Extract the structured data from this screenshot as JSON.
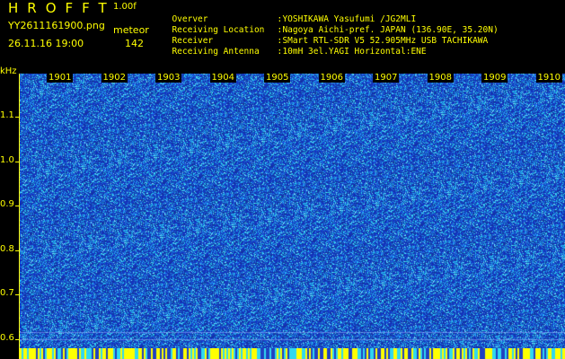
{
  "header": {
    "title": "HROFFT",
    "version": "1.00f",
    "filename": "YY2611161900.png",
    "datetime": "26.11.16 19:00",
    "meteor_label": "meteor",
    "meteor_count": "142"
  },
  "info": [
    {
      "label": "Overver",
      "value": "YOSHIKAWA Yasufumi /JG2MLI"
    },
    {
      "label": "Receiving Location",
      "value": "Nagoya Aichi-pref. JAPAN (136.90E, 35.20N)"
    },
    {
      "label": "Receiver",
      "value": "SMart RTL-SDR V5 52.905MHz USB TACHIKAWA"
    },
    {
      "label": "Receiving Antenna",
      "value": "10mH 3el.YAGI Horizontal:ENE"
    }
  ],
  "axis": {
    "unit": "kHz",
    "y_ticks": [
      "1.1",
      "1.0",
      "0.9",
      "0.8",
      "0.7",
      "0.6"
    ],
    "x_ticks": [
      "1901",
      "1902",
      "1903",
      "1904",
      "1905",
      "1906",
      "1907",
      "1908",
      "1909",
      "1910"
    ]
  },
  "colors": {
    "text": "#ffff00",
    "background": "#000000",
    "noise_base": "#1a2fb0",
    "noise_bright": "#33c0e8"
  },
  "separator": ":"
}
